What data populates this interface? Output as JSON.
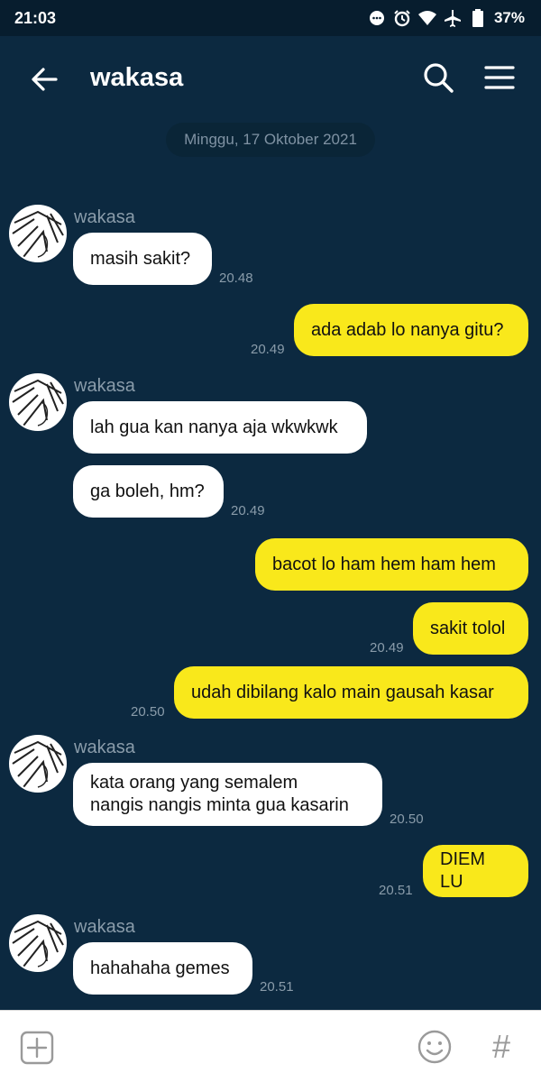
{
  "status_bar": {
    "time": "21:03",
    "battery": "37%"
  },
  "header": {
    "title": "wakasa"
  },
  "date_divider": "Minggu, 17 Oktober 2021",
  "sender_name": "wakasa",
  "messages": [
    {
      "dir": "in",
      "text": "masih sakit?",
      "time": "20.48"
    },
    {
      "dir": "out",
      "text": "ada adab lo nanya gitu?",
      "time": "20.49"
    },
    {
      "dir": "in",
      "text": "lah gua kan nanya aja wkwkwk",
      "time": ""
    },
    {
      "dir": "in",
      "text": "ga boleh, hm?",
      "time": "20.49"
    },
    {
      "dir": "out",
      "text": "bacot lo ham hem ham hem",
      "time": ""
    },
    {
      "dir": "out",
      "text": "sakit tolol",
      "time": "20.49"
    },
    {
      "dir": "out",
      "text": "udah dibilang kalo main gausah kasar",
      "time": "20.50"
    },
    {
      "dir": "in",
      "text": "kata orang yang semalem\nnangis nangis minta gua kasarin",
      "time": "20.50"
    },
    {
      "dir": "out",
      "text": "DIEM LU",
      "time": "20.51"
    },
    {
      "dir": "in",
      "text": "hahahaha gemes",
      "time": "20.51"
    }
  ],
  "icons": {
    "back": "arrow-left-icon",
    "search": "search-icon",
    "menu": "hamburger-menu-icon",
    "plus": "plus-square-icon",
    "emoji": "smiley-icon",
    "hash": "#"
  },
  "colors": {
    "background": "#0c2940",
    "incoming_bubble": "#ffffff",
    "outgoing_bubble": "#f9e81b"
  }
}
